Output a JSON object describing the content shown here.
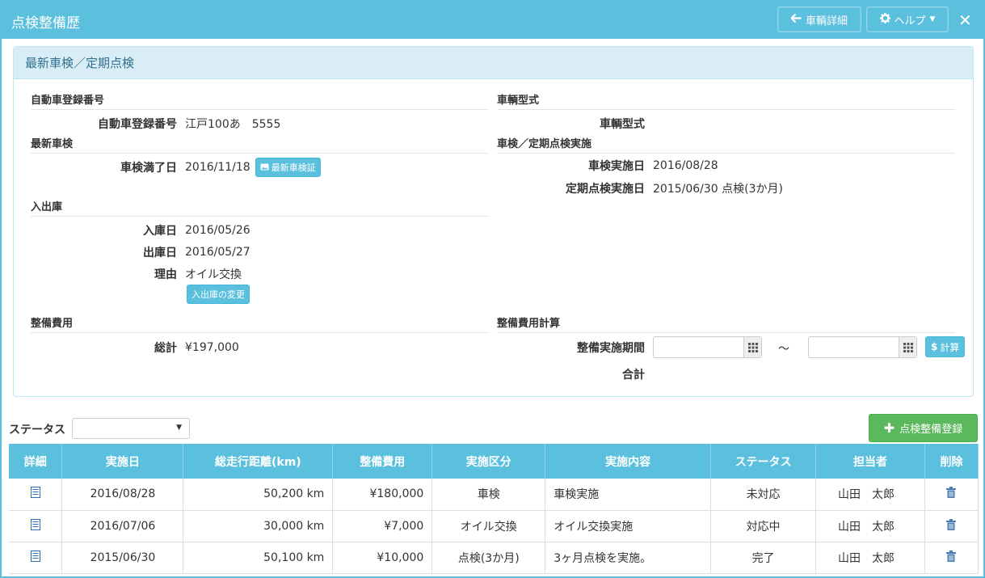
{
  "window": {
    "title": "点検整備歴",
    "back_label": "車輌詳細",
    "help_label": "ヘルプ"
  },
  "panel": {
    "title": "最新車検／定期点検"
  },
  "registration": {
    "section": "自動車登録番号",
    "label": "自動車登録番号",
    "value": "江戸100あ　5555"
  },
  "vehicle_type": {
    "section": "車輌型式",
    "label": "車輌型式",
    "value": ""
  },
  "latest_inspection": {
    "section": "最新車検",
    "label": "車検満了日",
    "value": "2016/11/18",
    "button": "最新車検証"
  },
  "inspection_exec": {
    "section": "車検／定期点検実施",
    "inspection_label": "車検実施日",
    "inspection_value": "2016/08/28",
    "periodic_label": "定期点検実施日",
    "periodic_value": "2015/06/30 点検(3か月)"
  },
  "garage": {
    "section": "入出庫",
    "in_label": "入庫日",
    "in_value": "2016/05/26",
    "out_label": "出庫日",
    "out_value": "2016/05/27",
    "reason_label": "理由",
    "reason_value": "オイル交換",
    "change_button": "入出庫の変更"
  },
  "cost": {
    "section": "整備費用",
    "total_label": "総計",
    "total_value": "¥197,000"
  },
  "cost_calc": {
    "section": "整備費用計算",
    "period_label": "整備実施期間",
    "tilde": "～",
    "calc_button": "計算",
    "sum_label": "合計"
  },
  "filter": {
    "status_label": "ステータス",
    "status_value": ""
  },
  "add_button": "点検整備登録",
  "table": {
    "headers": [
      "詳細",
      "実施日",
      "総走行距離(km)",
      "整備費用",
      "実施区分",
      "実施内容",
      "ステータス",
      "担当者",
      "削除"
    ],
    "rows": [
      {
        "date": "2016/08/28",
        "mileage": "50,200 km",
        "cost": "¥180,000",
        "category": "車検",
        "content": "車検実施",
        "status": "未対応",
        "person": "山田　太郎"
      },
      {
        "date": "2016/07/06",
        "mileage": "30,000 km",
        "cost": "¥7,000",
        "category": "オイル交換",
        "content": "オイル交換実施",
        "status": "対応中",
        "person": "山田　太郎"
      },
      {
        "date": "2015/06/30",
        "mileage": "50,100 km",
        "cost": "¥10,000",
        "category": "点検(3か月)",
        "content": "3ヶ月点検を実施。",
        "status": "完了",
        "person": "山田　太郎"
      }
    ]
  },
  "colors": {
    "accent": "#5bc0de",
    "success": "#5cb85c",
    "panel_head": "#d9edf7"
  }
}
